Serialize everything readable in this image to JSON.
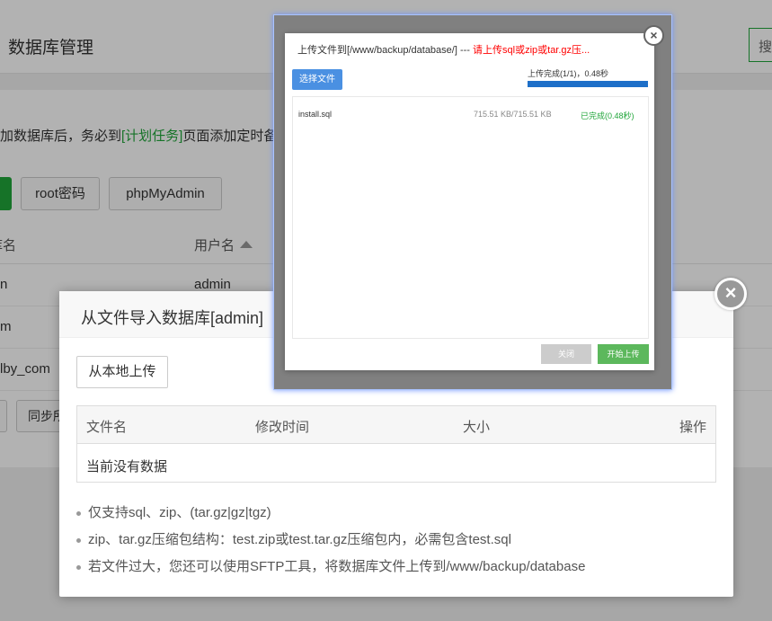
{
  "page": {
    "title": "数据库管理",
    "search_label": "搜",
    "notice": {
      "prefix": "加数据库后，务必到",
      "link": "[计划任务]",
      "suffix": "页面添加定时备"
    },
    "toolbar": {
      "root_password": "root密码",
      "phpmyadmin": "phpMyAdmin"
    },
    "table": {
      "col_name_fragment": "库名",
      "col_user": "用户名",
      "rows": [
        {
          "name_fragment": "n",
          "user": "admin"
        },
        {
          "name_fragment": "m",
          "user": ""
        },
        {
          "name_fragment": "lby_com",
          "user": ""
        }
      ]
    },
    "sync_button_fragment": "同步所"
  },
  "import_dialog": {
    "title": "从文件导入数据库[admin]",
    "local_upload": "从本地上传",
    "columns": {
      "file": "文件名",
      "mtime": "修改时间",
      "size": "大小",
      "action": "操作"
    },
    "empty": "当前没有数据",
    "tips": [
      "仅支持sql、zip、(tar.gz|gz|tgz)",
      "zip、tar.gz压缩包结构：test.zip或test.tar.gz压缩包内，必需包含test.sql",
      "若文件过大，您还可以使用SFTP工具，将数据库文件上传到/www/backup/database"
    ],
    "close_icon": "×"
  },
  "upload_dialog": {
    "title_path": "上传文件到[/www/backup/database/] --- ",
    "title_warning": "请上传sql或zip或tar.gz压...",
    "choose_file": "选择文件",
    "progress_text": "上传完成(1/1)，0.48秒",
    "progress_fraction": 1.0,
    "files": [
      {
        "name": "install.sql",
        "size": "715.51 KB/715.51 KB",
        "status": "已完成(0.48秒)"
      }
    ],
    "close_button": "关闭",
    "start_button": "开始上传",
    "close_icon": "×"
  },
  "colors": {
    "accent_green": "#20a53a",
    "progress_blue": "#1e6fc8",
    "choose_blue": "#4a90e2",
    "warning_red": "#ff0000"
  }
}
